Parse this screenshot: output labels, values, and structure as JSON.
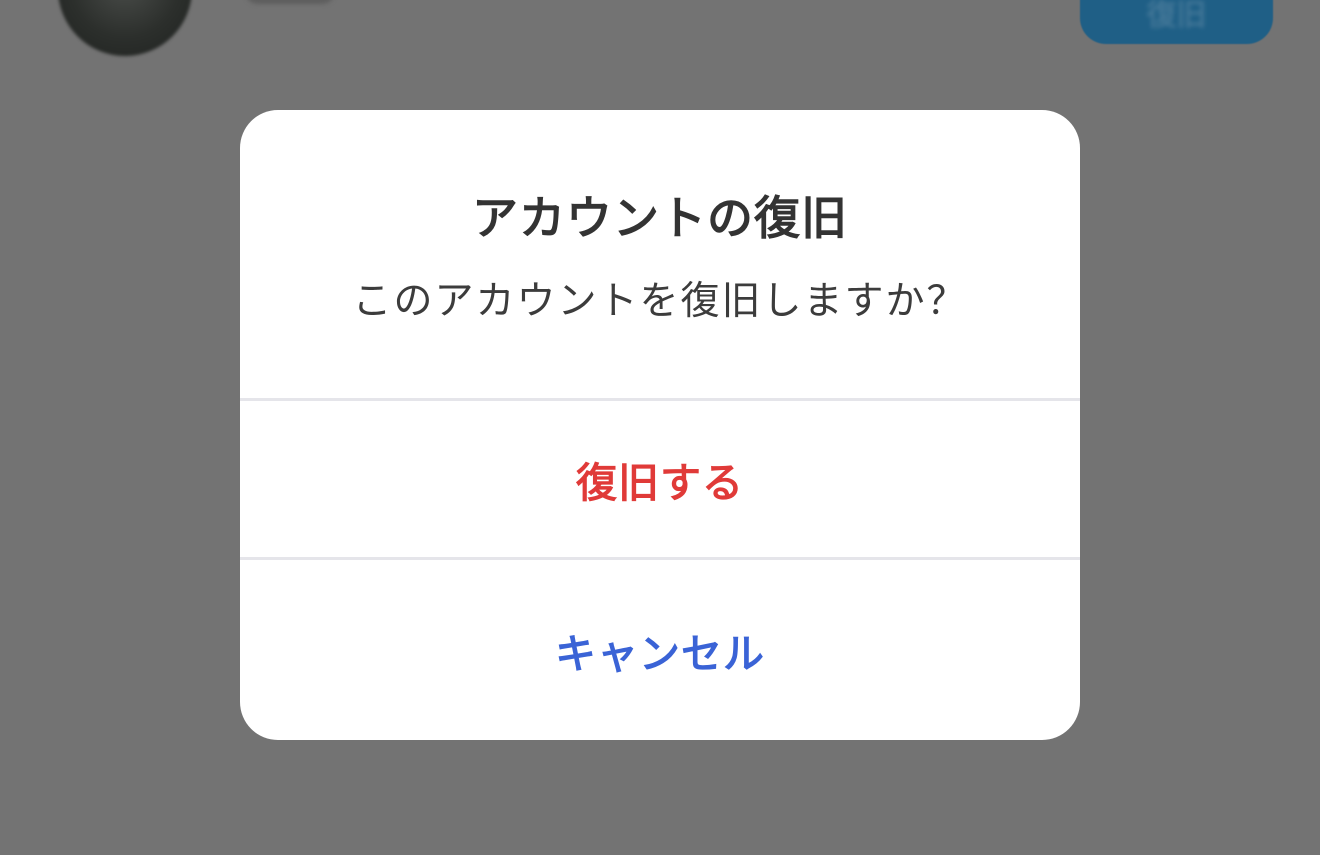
{
  "background": {
    "avatar_icon": "user-avatar",
    "action_button_label": "復旧"
  },
  "dialog": {
    "title": "アカウントの復旧",
    "message": "このアカウントを復旧しますか？",
    "buttons": [
      {
        "label": "復旧する",
        "color": "#e03a38",
        "role": "destructive"
      },
      {
        "label": "キャンセル",
        "color": "#3a63d6",
        "role": "cancel"
      }
    ]
  },
  "colors": {
    "overlay": "#737373",
    "dialog_background": "#ffffff",
    "divider": "#e5e5ea",
    "title_text": "#333333"
  }
}
